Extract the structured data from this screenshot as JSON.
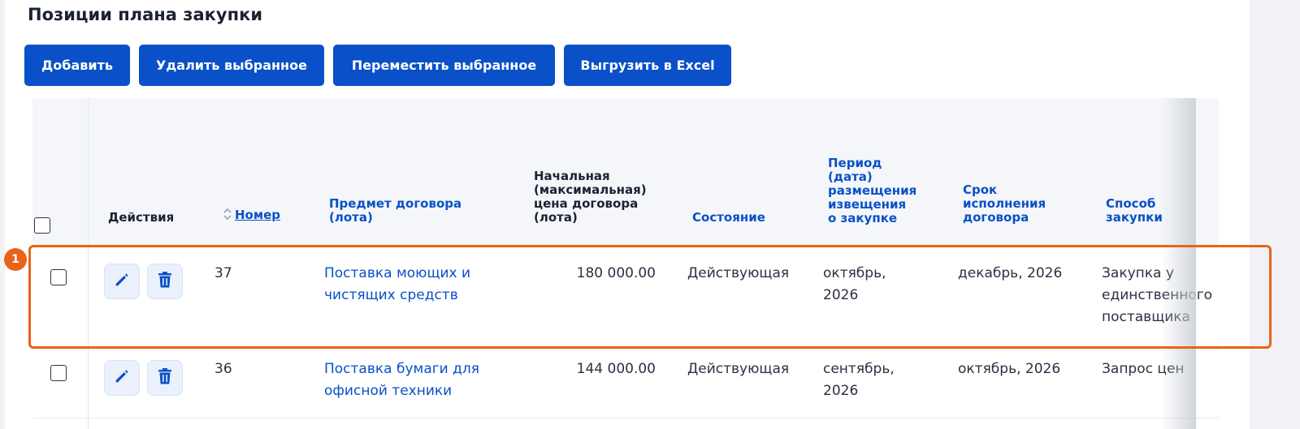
{
  "page": {
    "title": "Позиции плана закупки"
  },
  "toolbar": {
    "add_label": "Добавить",
    "delete_selected_label": "Удалить выбранное",
    "move_selected_label": "Переместить выбранное",
    "export_label": "Выгрузить в Excel"
  },
  "table": {
    "headers": {
      "actions": "Действия",
      "number": "Номер",
      "subject_lines": [
        "Предмет договора",
        "(лота)"
      ],
      "price_lines": [
        "Начальная",
        "(максимальная)",
        "цена договора",
        "(лота)"
      ],
      "status": "Состояние",
      "period_lines": [
        "Период",
        "(дата)",
        "размещения",
        "извещения",
        "о закупке"
      ],
      "term_lines": [
        "Срок",
        "исполнения",
        "договора"
      ],
      "method_lines": [
        "Способ",
        "закупки"
      ]
    },
    "rows": [
      {
        "number": "37",
        "subject_lines": [
          "Поставка моющих и",
          "чистящих средств"
        ],
        "price": "180 000.00",
        "status": "Действующая",
        "period_lines": [
          "октябрь,",
          "2026"
        ],
        "term": "декабрь, 2026",
        "method_lines": [
          "Закупка у",
          "единственного",
          "поставщика"
        ]
      },
      {
        "number": "36",
        "subject_lines": [
          "Поставка бумаги для",
          "офисной техники"
        ],
        "price": "144 000.00",
        "status": "Действующая",
        "period_lines": [
          "сентябрь,",
          "2026"
        ],
        "term": "октябрь, 2026",
        "method_lines": [
          "Запрос цен"
        ]
      }
    ]
  },
  "annotation": {
    "marker_label": "1"
  },
  "colors": {
    "primary": "#0a50c8",
    "highlight": "#e9631a"
  },
  "icons": [
    "pencil-icon",
    "trash-icon",
    "sort-icon"
  ]
}
